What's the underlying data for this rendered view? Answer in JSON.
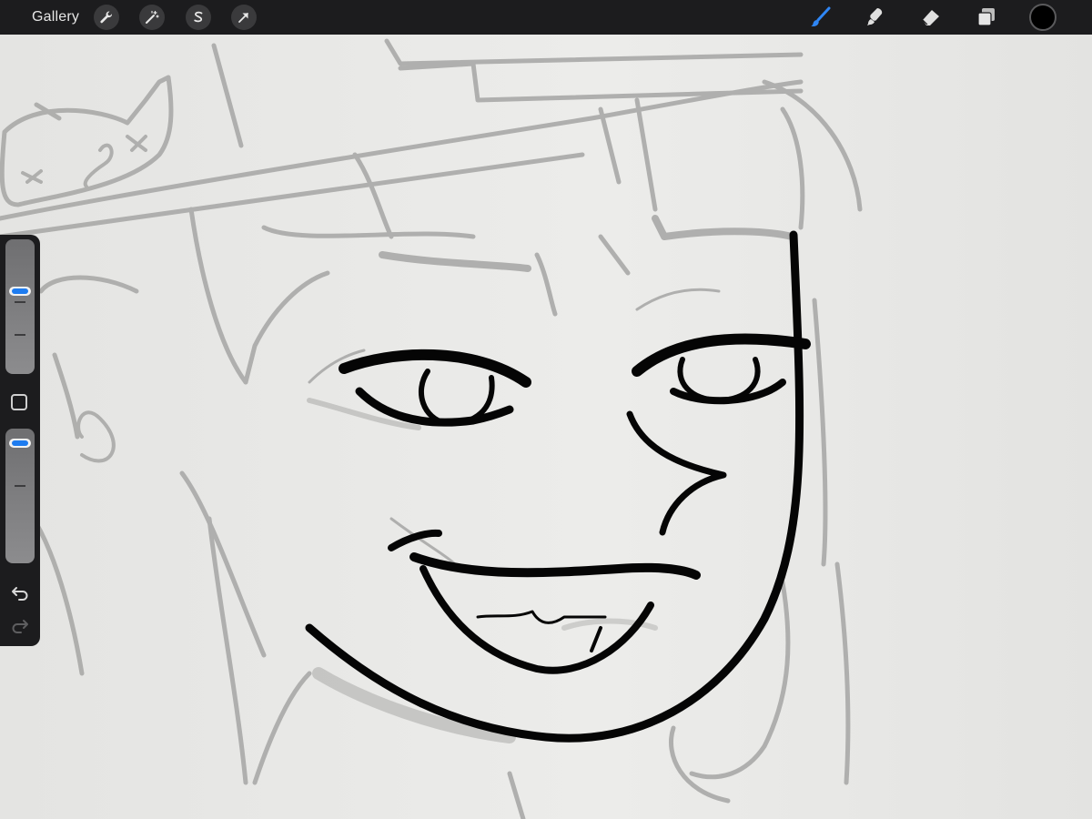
{
  "toolbar": {
    "gallery_label": "Gallery",
    "left_tools": [
      "wrench-icon",
      "magic-wand-icon",
      "selection-s-icon",
      "transform-arrow-icon"
    ],
    "right_tools": [
      "brush-icon",
      "smudge-icon",
      "eraser-icon",
      "layers-icon"
    ],
    "active_tool": "brush-icon",
    "current_color": "#000000"
  },
  "sidebar": {
    "brush_size_level": 0.62,
    "brush_opacity_level": 0.92,
    "buttons": [
      "modifier-square-icon",
      "undo-icon",
      "redo-icon"
    ]
  },
  "theme": {
    "toolbar_bg": "#1c1c1e",
    "accent": "#1e7cf0",
    "canvas_bg": "#e9e9e7"
  }
}
